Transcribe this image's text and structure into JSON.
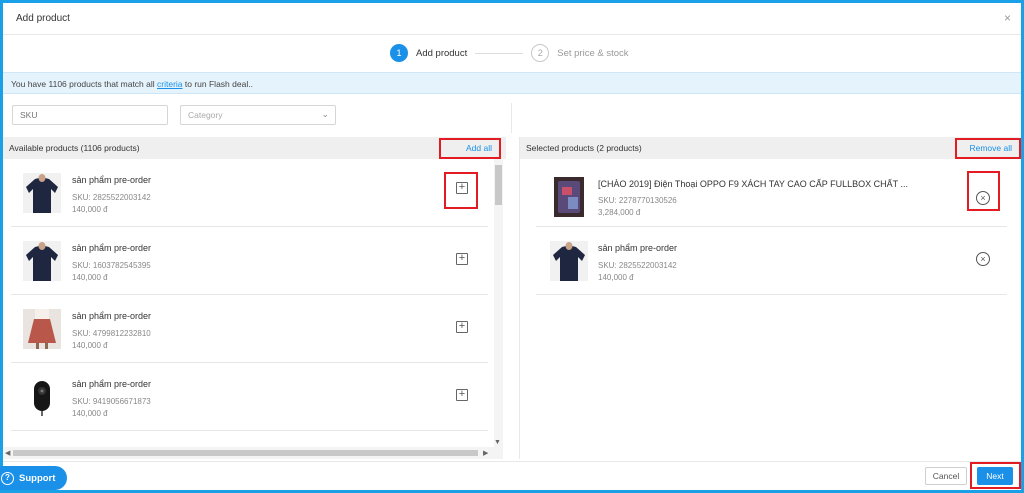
{
  "modal": {
    "title": "Add product",
    "close": "×"
  },
  "stepper": {
    "step1_num": "1",
    "step1_label": "Add product",
    "step2_num": "2",
    "step2_label": "Set price & stock"
  },
  "banner": {
    "text_before": "You have 1106 products that match all ",
    "link": "criteria",
    "text_after": " to run Flash deal.."
  },
  "filters": {
    "sku_placeholder": "SKU",
    "category_placeholder": "Category"
  },
  "available": {
    "title": "Available products (1106 products)",
    "add_all": "Add all",
    "items": [
      {
        "name": "sản phẩm pre-order",
        "sku": "SKU: 2825522003142",
        "price": "140,000 đ",
        "thumb": "sweater-thumbnail"
      },
      {
        "name": "sản phẩm pre-order",
        "sku": "SKU: 1603782545395",
        "price": "140,000 đ",
        "thumb": "sweater-thumbnail"
      },
      {
        "name": "sản phẩm pre-order",
        "sku": "SKU: 4799812232810",
        "price": "140,000 đ",
        "thumb": "skirt-thumbnail"
      },
      {
        "name": "sản phẩm pre-order",
        "sku": "SKU: 9419056671873",
        "price": "140,000 đ",
        "thumb": "remote-thumbnail"
      }
    ]
  },
  "selected": {
    "title": "Selected products (2 products)",
    "remove_all": "Remove all",
    "items": [
      {
        "name": "[CHÀO 2019] Điện Thoại OPPO F9 XÁCH TAY CAO CẤP FULLBOX CHẤT ...",
        "sku": "SKU: 2278770130526",
        "price": "3,284,000 đ",
        "thumb": "phone-thumbnail"
      },
      {
        "name": "sản phẩm pre-order",
        "sku": "SKU: 2825522003142",
        "price": "140,000 đ",
        "thumb": "sweater-thumbnail"
      }
    ]
  },
  "footer": {
    "support": "Support",
    "cancel": "Cancel",
    "next": "Next"
  },
  "colors": {
    "accent": "#1a90e8",
    "highlight_box": "#e31b23",
    "frame": "#1aa0e6"
  }
}
